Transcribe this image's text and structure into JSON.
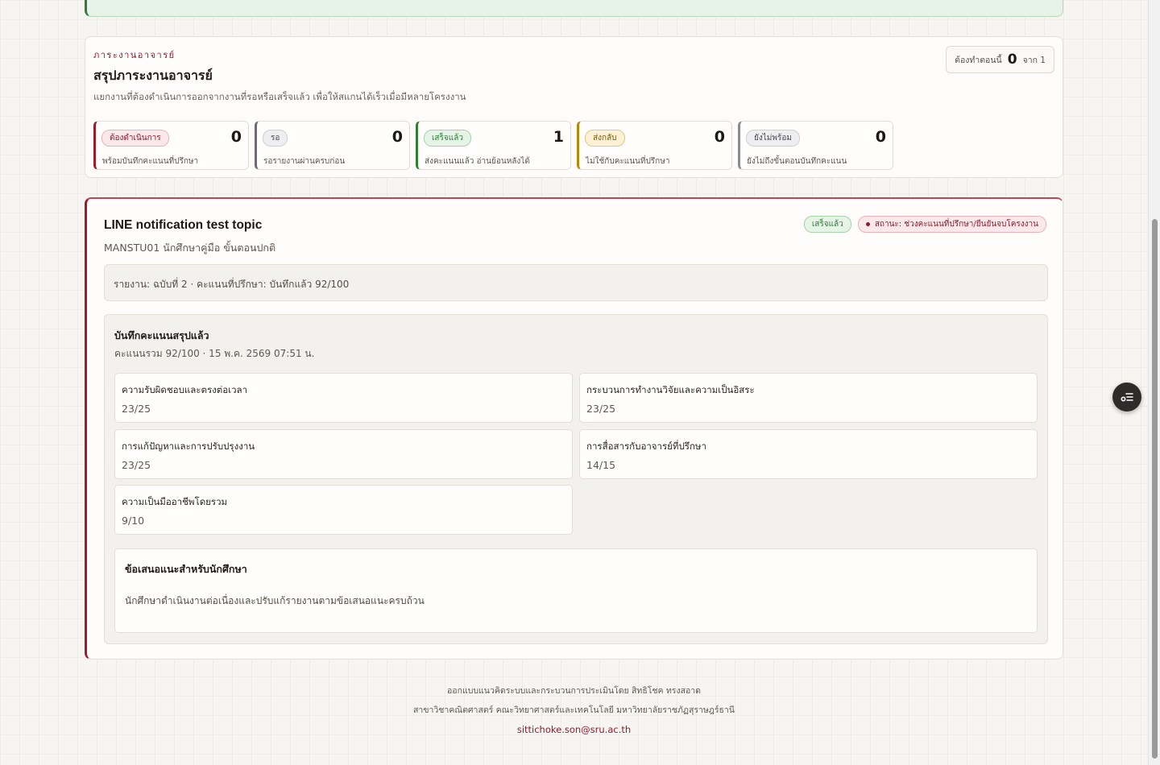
{
  "workload": {
    "eyebrow": "ภาระงานอาจารย์",
    "title": "สรุปภาระงานอาจารย์",
    "description": "แยกงานที่ต้องดำเนินการออกจากงานที่รอหรือเสร็จแล้ว เพื่อให้สแกนได้เร็วเมื่อมีหลายโครงงาน",
    "todo_label": "ต้องทำตอนนี้",
    "todo_count": "0",
    "todo_of": "จาก 1",
    "stats": [
      {
        "badge": "ต้องดำเนินการ",
        "count": "0",
        "note": "พร้อมบันทึกคะแนนที่ปรึกษา",
        "color": "#9b1c2c"
      },
      {
        "badge": "รอ",
        "count": "0",
        "note": "รอรายงานผ่านครบก่อน",
        "color": "#6b6b78"
      },
      {
        "badge": "เสร็จแล้ว",
        "count": "1",
        "note": "ส่งคะแนนแล้ว อ่านย้อนหลังได้",
        "color": "#2e7d32"
      },
      {
        "badge": "ส่งกลับ",
        "count": "0",
        "note": "ไม่ใช้กับคะแนนที่ปรึกษา",
        "color": "#b8860b"
      },
      {
        "badge": "ยังไม่พร้อม",
        "count": "0",
        "note": "ยังไม่ถึงขั้นตอนบันทึกคะแนน",
        "color": "#8a8a94"
      }
    ]
  },
  "project": {
    "title": "LINE notification test topic",
    "subtitle": "MANSTU01 นักศึกษาคู่มือ ขั้นตอนปกติ",
    "badge_done": "เสร็จแล้ว",
    "badge_status": "สถานะ: ช่วงคะแนนที่ปรึกษา/ยืนยันจบโครงงาน",
    "report_line": "รายงาน: ฉบับที่ 2 · คะแนนที่ปรึกษา: บันทึกแล้ว 92/100",
    "scores": {
      "title": "บันทึกคะแนนสรุปแล้ว",
      "meta": "คะแนนรวม 92/100 · 15 พ.ค. 2569 07:51 น.",
      "criteria": [
        {
          "label": "ความรับผิดชอบและตรงต่อเวลา",
          "score": "23/25"
        },
        {
          "label": "กระบวนการทำงานวิจัยและความเป็นอิสระ",
          "score": "23/25"
        },
        {
          "label": "การแก้ปัญหาและการปรับปรุงงาน",
          "score": "23/25"
        },
        {
          "label": "การสื่อสารกับอาจารย์ที่ปรึกษา",
          "score": "14/15"
        },
        {
          "label": "ความเป็นมืออาชีพโดยรวม",
          "score": "9/10"
        }
      ],
      "recommendation_title": "ข้อเสนอแนะสำหรับนักศึกษา",
      "recommendation_text": "นักศึกษาดำเนินงานต่อเนื่องและปรับแก้รายงานตามข้อเสนอแนะครบถ้วน"
    }
  },
  "footer": {
    "line1": "ออกแบบแนวคิดระบบและกระบวนการประเมินโดย สิทธิโชค ทรงสอาด",
    "line2": "สาขาวิชาคณิตศาสตร์ คณะวิทยาศาสตร์และเทคโนโลยี มหาวิทยาลัยราชภัฏสุราษฎร์ธานี",
    "email": "sittichoke.son@sru.ac.th"
  },
  "fab_icon": "list-settings-icon"
}
